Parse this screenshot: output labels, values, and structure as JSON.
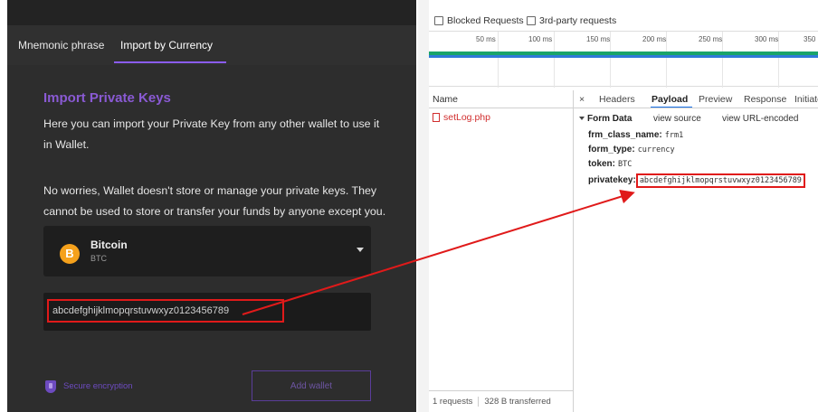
{
  "wallet": {
    "tabs": [
      {
        "label": "Mnemonic phrase"
      },
      {
        "label": "Import by Currency"
      }
    ],
    "heading": "Import Private Keys",
    "paragraph_1": "Here you can import your Private Key from any other wallet to use it in Wallet.",
    "paragraph_2": "No worries, Wallet doesn't store or manage your private keys. They cannot be used to store or transfer your funds by anyone except you.",
    "currency": {
      "icon_glyph": "B",
      "name": "Bitcoin",
      "symbol": "BTC",
      "icon": "bitcoin-icon"
    },
    "private_key_value": "abcdefghijklmopqrstuvwxyz0123456789",
    "secure_label": "Secure encryption",
    "add_button_label": "Add wallet",
    "colors": {
      "accent": "#8b5cf6",
      "highlight": "#e01a1a",
      "bitcoin": "#f5a11c"
    }
  },
  "devtools": {
    "filters": [
      {
        "label": "Blocked Requests"
      },
      {
        "label": "3rd-party requests"
      }
    ],
    "timeline_ticks": [
      "50 ms",
      "100 ms",
      "150 ms",
      "200 ms",
      "250 ms",
      "300 ms",
      "350"
    ],
    "name_header": "Name",
    "requests": [
      {
        "name": "setLog.php"
      }
    ],
    "footer": {
      "requests": "1 requests",
      "transferred": "328 B transferred"
    },
    "detail_tabs": {
      "close": "×",
      "headers": "Headers",
      "payload": "Payload",
      "preview": "Preview",
      "response": "Response",
      "initiator": "Initiator"
    },
    "form_data": {
      "title": "Form Data",
      "view_source": "view source",
      "view_url_encoded": "view URL-encoded",
      "fields": [
        {
          "key": "frm_class_name:",
          "value": "frm1"
        },
        {
          "key": "form_type:",
          "value": "currency"
        },
        {
          "key": "token:",
          "value": "BTC"
        },
        {
          "key": "privatekey:",
          "value": "abcdefghijklmopqrstuvwxyz0123456789"
        }
      ]
    }
  }
}
